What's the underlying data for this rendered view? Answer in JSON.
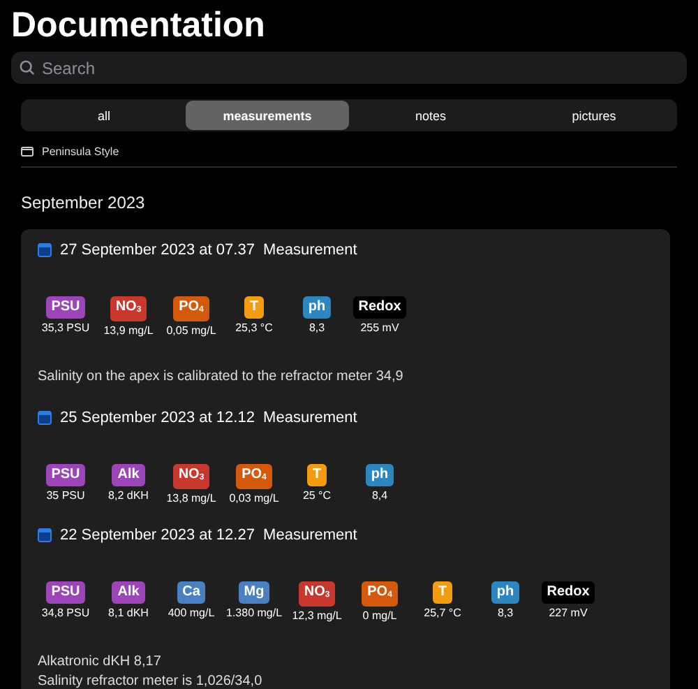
{
  "title": "Documentation",
  "search": {
    "placeholder": "Search"
  },
  "tabs": [
    {
      "label": "all",
      "selected": false
    },
    {
      "label": "measurements",
      "selected": true
    },
    {
      "label": "notes",
      "selected": false
    },
    {
      "label": "pictures",
      "selected": false
    }
  ],
  "style_row": {
    "label": "Peninsula Style"
  },
  "section": "September 2023",
  "entries": [
    {
      "date": "27 September 2023 at 07.37",
      "type": "Measurement",
      "measurements": [
        {
          "badge": "PSU",
          "color": "#9b45b8",
          "value": "35,3 PSU"
        },
        {
          "badge": "NO$_{3}$",
          "color": "#c8382e",
          "value": "13,9 mg/L"
        },
        {
          "badge": "PO$_{4}$",
          "color": "#d35a0c",
          "value": "0,05 mg/L"
        },
        {
          "badge": "T",
          "color": "#f39c12",
          "value": "25,3 °C"
        },
        {
          "badge": "ph",
          "color": "#2e86c1",
          "value": "8,3"
        },
        {
          "badge": "Redox",
          "color": "#000000",
          "value": "255 mV"
        }
      ],
      "notes": [
        "Salinity on the apex is calibrated to the refractor meter 34,9"
      ]
    },
    {
      "date": "25 September 2023 at 12.12",
      "type": "Measurement",
      "measurements": [
        {
          "badge": "PSU",
          "color": "#9b45b8",
          "value": "35 PSU"
        },
        {
          "badge": "Alk",
          "color": "#9b45b8",
          "value": "8,2 dKH"
        },
        {
          "badge": "NO$_{3}$",
          "color": "#c8382e",
          "value": "13,8 mg/L"
        },
        {
          "badge": "PO$_{4}$",
          "color": "#d35a0c",
          "value": "0,03 mg/L"
        },
        {
          "badge": "T",
          "color": "#f39c12",
          "value": "25 °C"
        },
        {
          "badge": "ph",
          "color": "#2e86c1",
          "value": "8,4"
        }
      ]
    },
    {
      "date": "22 September 2023 at 12.27",
      "type": "Measurement",
      "measurements": [
        {
          "badge": "PSU",
          "color": "#9b45b8",
          "value": "34,8 PSU"
        },
        {
          "badge": "Alk",
          "color": "#9b45b8",
          "value": "8,1 dKH"
        },
        {
          "badge": "Ca",
          "color": "#4a7fc1",
          "value": "400 mg/L"
        },
        {
          "badge": "Mg",
          "color": "#4a7fc1",
          "value": "1.380 mg/L"
        },
        {
          "badge": "NO$_{3}$",
          "color": "#c8382e",
          "value": "12,3 mg/L"
        },
        {
          "badge": "PO$_{4}$",
          "color": "#d35a0c",
          "value": "0 mg/L"
        },
        {
          "badge": "T",
          "color": "#f39c12",
          "value": "25,7 °C"
        },
        {
          "badge": "ph",
          "color": "#2e86c1",
          "value": "8,3"
        },
        {
          "badge": "Redox",
          "color": "#000000",
          "value": "227 mV"
        }
      ],
      "notes": [
        "Alkatronic dKH 8,17",
        "Salinity refractor meter is 1,026/34,0"
      ]
    }
  ]
}
